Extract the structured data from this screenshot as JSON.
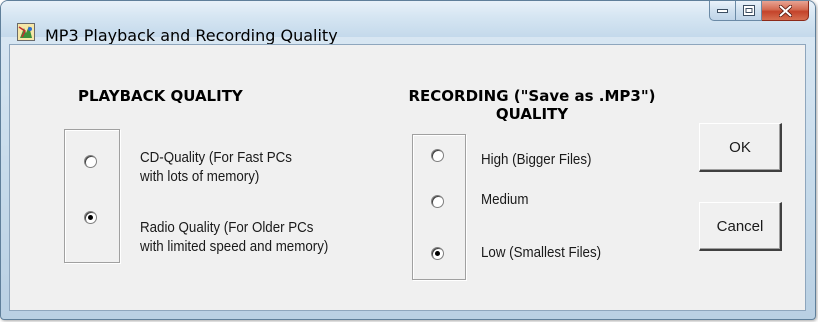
{
  "window": {
    "title": "MP3 Playback and Recording Quality",
    "icon": "app-icon"
  },
  "caption_buttons": {
    "minimize": "minimize-icon",
    "maximize": "maximize-icon",
    "close": "close-icon"
  },
  "playback": {
    "heading": "PLAYBACK QUALITY",
    "options": [
      {
        "label": "CD-Quality (For Fast PCs\nwith lots of memory)",
        "selected": false
      },
      {
        "label": "Radio Quality (For Older PCs\nwith limited speed and memory)",
        "selected": true
      }
    ]
  },
  "recording": {
    "heading": "RECORDING (\"Save as .MP3\")\nQUALITY",
    "options": [
      {
        "label": "High (Bigger Files)",
        "selected": false
      },
      {
        "label": "Medium",
        "selected": false
      },
      {
        "label": "Low (Smallest Files)",
        "selected": true
      }
    ]
  },
  "buttons": {
    "ok": "OK",
    "cancel": "Cancel"
  },
  "colors": {
    "close_button": "#c4432a",
    "client_background": "#f0f0f0"
  }
}
